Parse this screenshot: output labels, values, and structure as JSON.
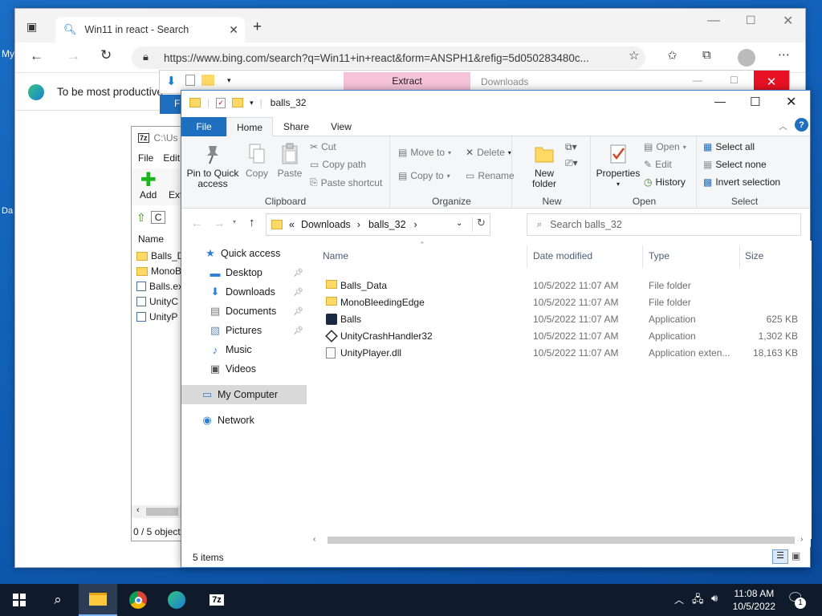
{
  "desktop": {
    "label_my": "My",
    "label_da": "Da"
  },
  "browser": {
    "tab_title": "Win11 in react - Search",
    "address": "https://www.bing.com/search?q=Win11+in+react&form=ANSPH1&refig=5d050283480c...",
    "message": "To be most productive"
  },
  "sevenz": {
    "title": "C:\\Us",
    "menu_file": "File",
    "menu_edit": "Edit",
    "add_label": "Add",
    "extract_label": "Ext",
    "path": "C",
    "col_name": "Name",
    "items": [
      "Balls_D",
      "MonoB",
      "Balls.ex",
      "UnityC",
      "UnityP"
    ],
    "status": "0 / 5 object"
  },
  "downloads_win": {
    "extract_tab": "Extract",
    "title": "Downloads",
    "file_tab": "F"
  },
  "explorer": {
    "title": "balls_32",
    "tabs": {
      "file": "File",
      "home": "Home",
      "share": "Share",
      "view": "View"
    },
    "ribbon": {
      "clipboard": {
        "pin": "Pin to Quick access",
        "copy": "Copy",
        "paste": "Paste",
        "cut": "Cut",
        "copy_path": "Copy path",
        "paste_shortcut": "Paste shortcut",
        "label": "Clipboard"
      },
      "organize": {
        "move_to": "Move to",
        "copy_to": "Copy to",
        "delete": "Delete",
        "rename": "Rename",
        "label": "Organize"
      },
      "new": {
        "new_folder": "New folder",
        "label": "New"
      },
      "open": {
        "properties": "Properties",
        "open": "Open",
        "edit": "Edit",
        "history": "History",
        "label": "Open"
      },
      "select": {
        "select_all": "Select all",
        "select_none": "Select none",
        "invert": "Invert selection",
        "label": "Select"
      }
    },
    "breadcrumb": [
      "Downloads",
      "balls_32"
    ],
    "search_placeholder": "Search balls_32",
    "nav": [
      {
        "label": "Quick access",
        "pinned": false
      },
      {
        "label": "Desktop",
        "pinned": true
      },
      {
        "label": "Downloads",
        "pinned": true
      },
      {
        "label": "Documents",
        "pinned": true
      },
      {
        "label": "Pictures",
        "pinned": true
      },
      {
        "label": "Music",
        "pinned": false
      },
      {
        "label": "Videos",
        "pinned": false
      },
      {
        "label": "My Computer",
        "pinned": false
      },
      {
        "label": "Network",
        "pinned": false
      }
    ],
    "columns": {
      "name": "Name",
      "date": "Date modified",
      "type": "Type",
      "size": "Size"
    },
    "files": [
      {
        "name": "Balls_Data",
        "date": "10/5/2022 11:07 AM",
        "type": "File folder",
        "size": "",
        "icon": "folder-icon"
      },
      {
        "name": "MonoBleedingEdge",
        "date": "10/5/2022 11:07 AM",
        "type": "File folder",
        "size": "",
        "icon": "folder-icon"
      },
      {
        "name": "Balls",
        "date": "10/5/2022 11:07 AM",
        "type": "Application",
        "size": "625 KB",
        "icon": "unity-app-icon"
      },
      {
        "name": "UnityCrashHandler32",
        "date": "10/5/2022 11:07 AM",
        "type": "Application",
        "size": "1,302 KB",
        "icon": "unity-logo-icon"
      },
      {
        "name": "UnityPlayer.dll",
        "date": "10/5/2022 11:07 AM",
        "type": "Application exten...",
        "size": "18,163 KB",
        "icon": "dll-file-icon"
      }
    ],
    "status": "5 items"
  },
  "taskbar": {
    "time": "11:08 AM",
    "date": "10/5/2022",
    "notif_count": "1",
    "sevenz_label": "7z"
  }
}
